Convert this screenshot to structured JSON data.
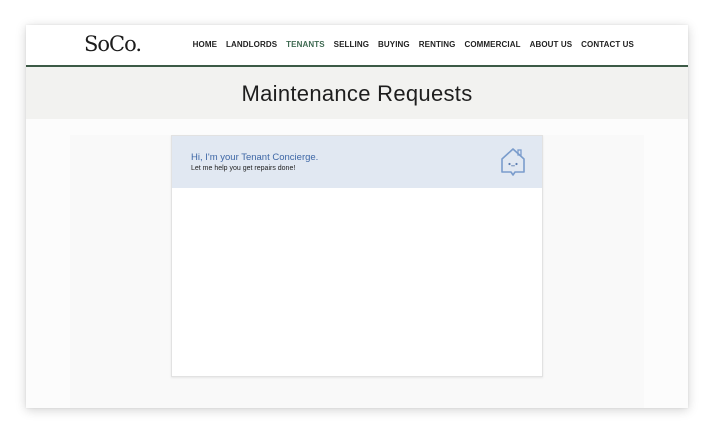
{
  "header": {
    "logo": "SoCo.",
    "nav": [
      "HOME",
      "LANDLORDS",
      "TENANTS",
      "SELLING",
      "BUYING",
      "RENTING",
      "COMMERCIAL",
      "ABOUT US",
      "CONTACT US"
    ],
    "active_nav": "TENANTS"
  },
  "page": {
    "title": "Maintenance Requests"
  },
  "concierge": {
    "greeting": "Hi, I'm your Tenant Concierge.",
    "subtext": "Let me help you get repairs done!",
    "icon": "house-face-icon"
  },
  "colors": {
    "header_border": "#3c5a46",
    "active_nav": "#3f6a52",
    "concierge_header_bg": "#e1e8f2",
    "concierge_text": "#3e67a6"
  }
}
